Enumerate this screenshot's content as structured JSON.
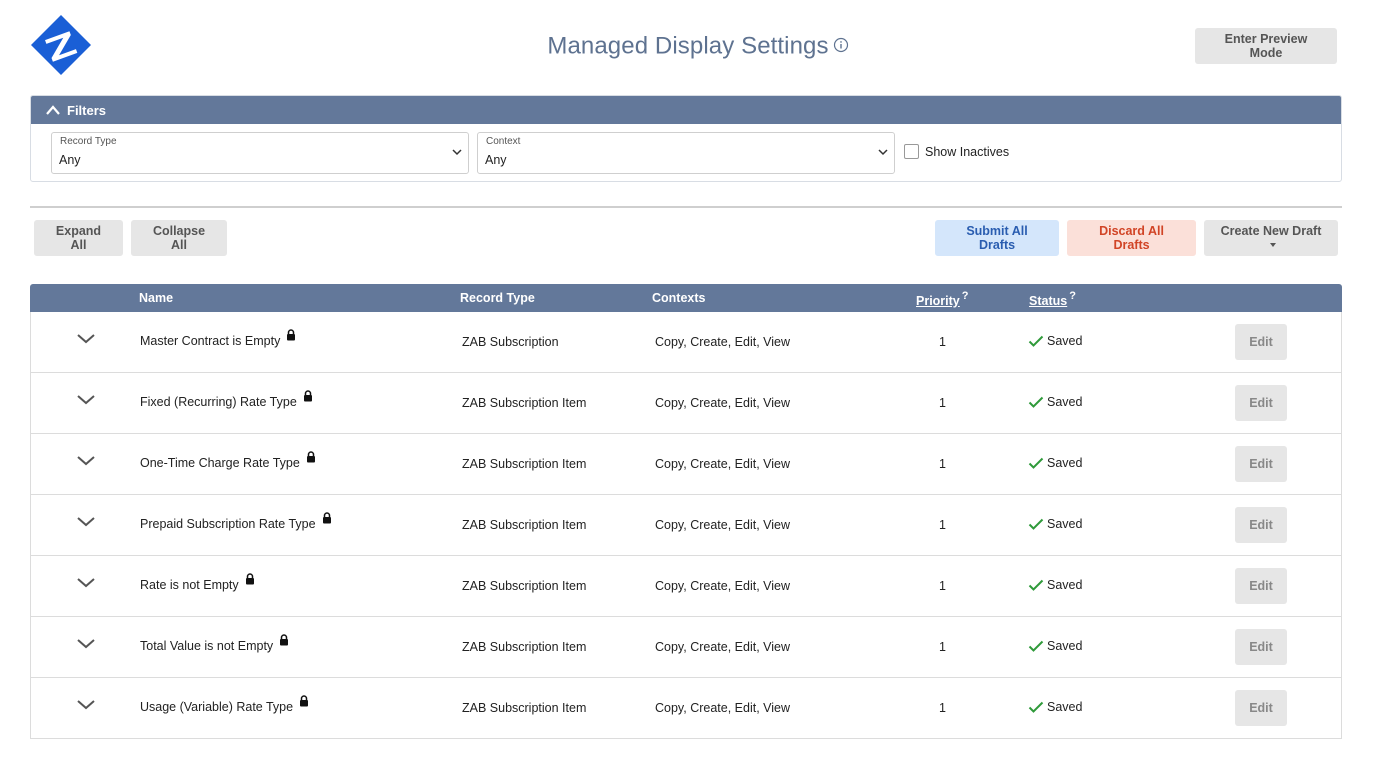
{
  "header": {
    "title": "Managed Display Settings",
    "preview_button": "Enter Preview Mode"
  },
  "filters": {
    "title": "Filters",
    "record_type": {
      "label": "Record Type",
      "value": "Any"
    },
    "context": {
      "label": "Context",
      "value": "Any"
    },
    "show_inactives_label": "Show Inactives"
  },
  "toolbar": {
    "expand_all": "Expand All",
    "collapse_all": "Collapse All",
    "submit_all": "Submit All Drafts",
    "discard_all": "Discard All Drafts",
    "create_new": "Create New Draft"
  },
  "table": {
    "columns": {
      "name": "Name",
      "record_type": "Record Type",
      "contexts": "Contexts",
      "priority": "Priority",
      "status": "Status",
      "help_mark": "?"
    },
    "edit_label": "Edit",
    "rows": [
      {
        "name": "Master Contract is Empty",
        "record_type": "ZAB Subscription",
        "contexts": "Copy, Create, Edit, View",
        "priority": "1",
        "status": "Saved"
      },
      {
        "name": "Fixed (Recurring) Rate Type",
        "record_type": "ZAB Subscription Item",
        "contexts": "Copy, Create, Edit, View",
        "priority": "1",
        "status": "Saved"
      },
      {
        "name": "One-Time Charge Rate Type",
        "record_type": "ZAB Subscription Item",
        "contexts": "Copy, Create, Edit, View",
        "priority": "1",
        "status": "Saved"
      },
      {
        "name": "Prepaid Subscription Rate Type",
        "record_type": "ZAB Subscription Item",
        "contexts": "Copy, Create, Edit, View",
        "priority": "1",
        "status": "Saved"
      },
      {
        "name": "Rate is not Empty",
        "record_type": "ZAB Subscription Item",
        "contexts": "Copy, Create, Edit, View",
        "priority": "1",
        "status": "Saved"
      },
      {
        "name": "Total Value is not Empty",
        "record_type": "ZAB Subscription Item",
        "contexts": "Copy, Create, Edit, View",
        "priority": "1",
        "status": "Saved"
      },
      {
        "name": "Usage (Variable) Rate Type",
        "record_type": "ZAB Subscription Item",
        "contexts": "Copy, Create, Edit, View",
        "priority": "1",
        "status": "Saved"
      }
    ]
  },
  "colors": {
    "header_bar": "#63789a",
    "title_text": "#5e7290",
    "logo_blue": "#1a5fd6",
    "saved_green": "#2f9a3a",
    "submit_bg": "#d4e6fb",
    "discard_bg": "#fbe0d9"
  },
  "icons": {
    "logo": "zab-diamond-logo",
    "info": "info-circle-icon",
    "collapse": "chevron-up-icon",
    "dropdown": "chevron-down-icon",
    "expand_row": "chevron-down-icon",
    "lock": "lock-icon",
    "status": "check-icon"
  }
}
